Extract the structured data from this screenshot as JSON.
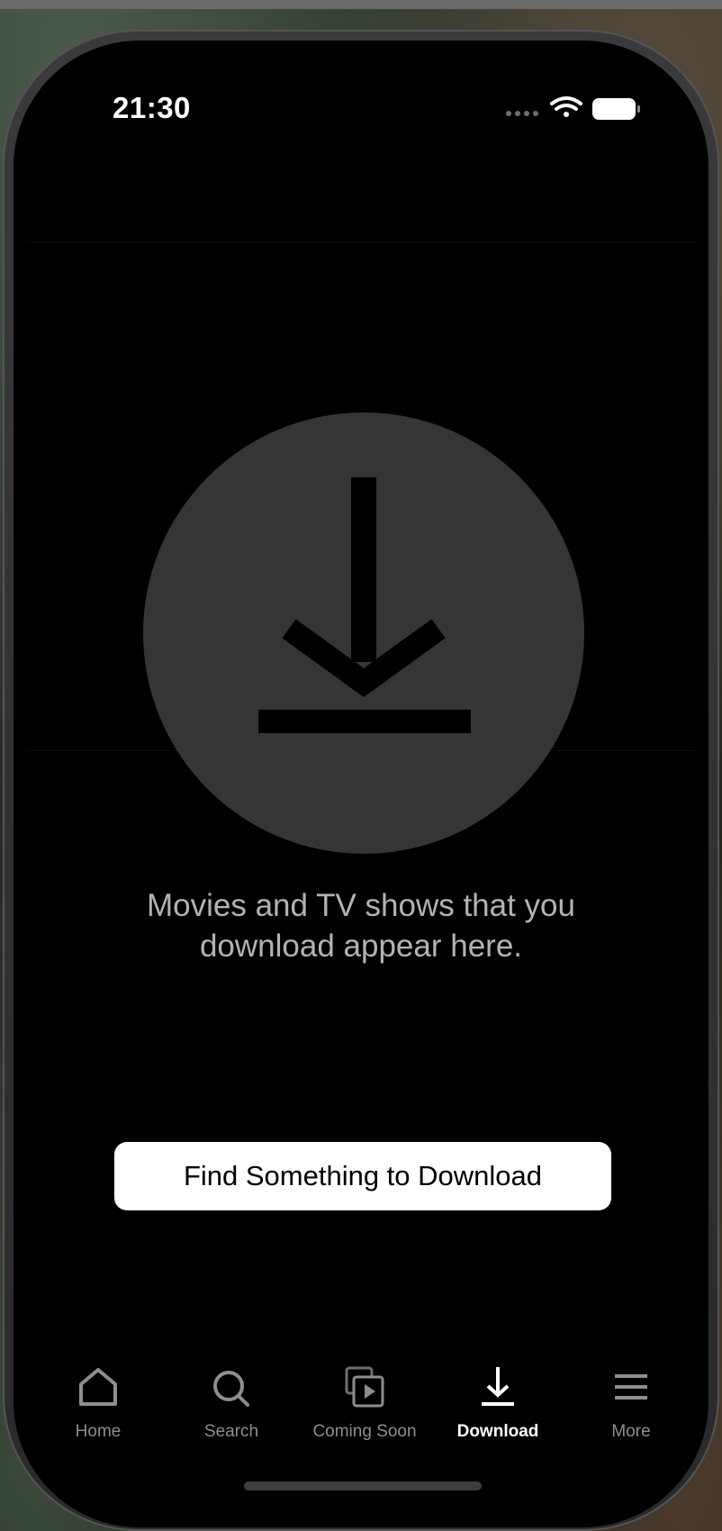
{
  "status_bar": {
    "time": "21:30",
    "icons": [
      "signal-dots-icon",
      "wifi-icon",
      "battery-icon"
    ]
  },
  "empty_state": {
    "icon": "download-icon",
    "message_line1": "Movies and TV shows that you",
    "message_line2": "download appear here.",
    "button_label": "Find Something to Download"
  },
  "tab_bar": {
    "active": "Download",
    "tabs": [
      {
        "label": "Home",
        "icon": "home-icon"
      },
      {
        "label": "Search",
        "icon": "search-icon"
      },
      {
        "label": "Coming Soon",
        "icon": "coming-soon-icon"
      },
      {
        "label": "Download",
        "icon": "download-icon"
      },
      {
        "label": "More",
        "icon": "menu-icon"
      }
    ]
  },
  "colors": {
    "screen_background": "#000000",
    "circle_fill": "#353535",
    "message_text": "#b3b3b3",
    "button_background": "#ffffff",
    "tab_inactive": "#8e8e8e",
    "tab_active": "#ffffff"
  }
}
